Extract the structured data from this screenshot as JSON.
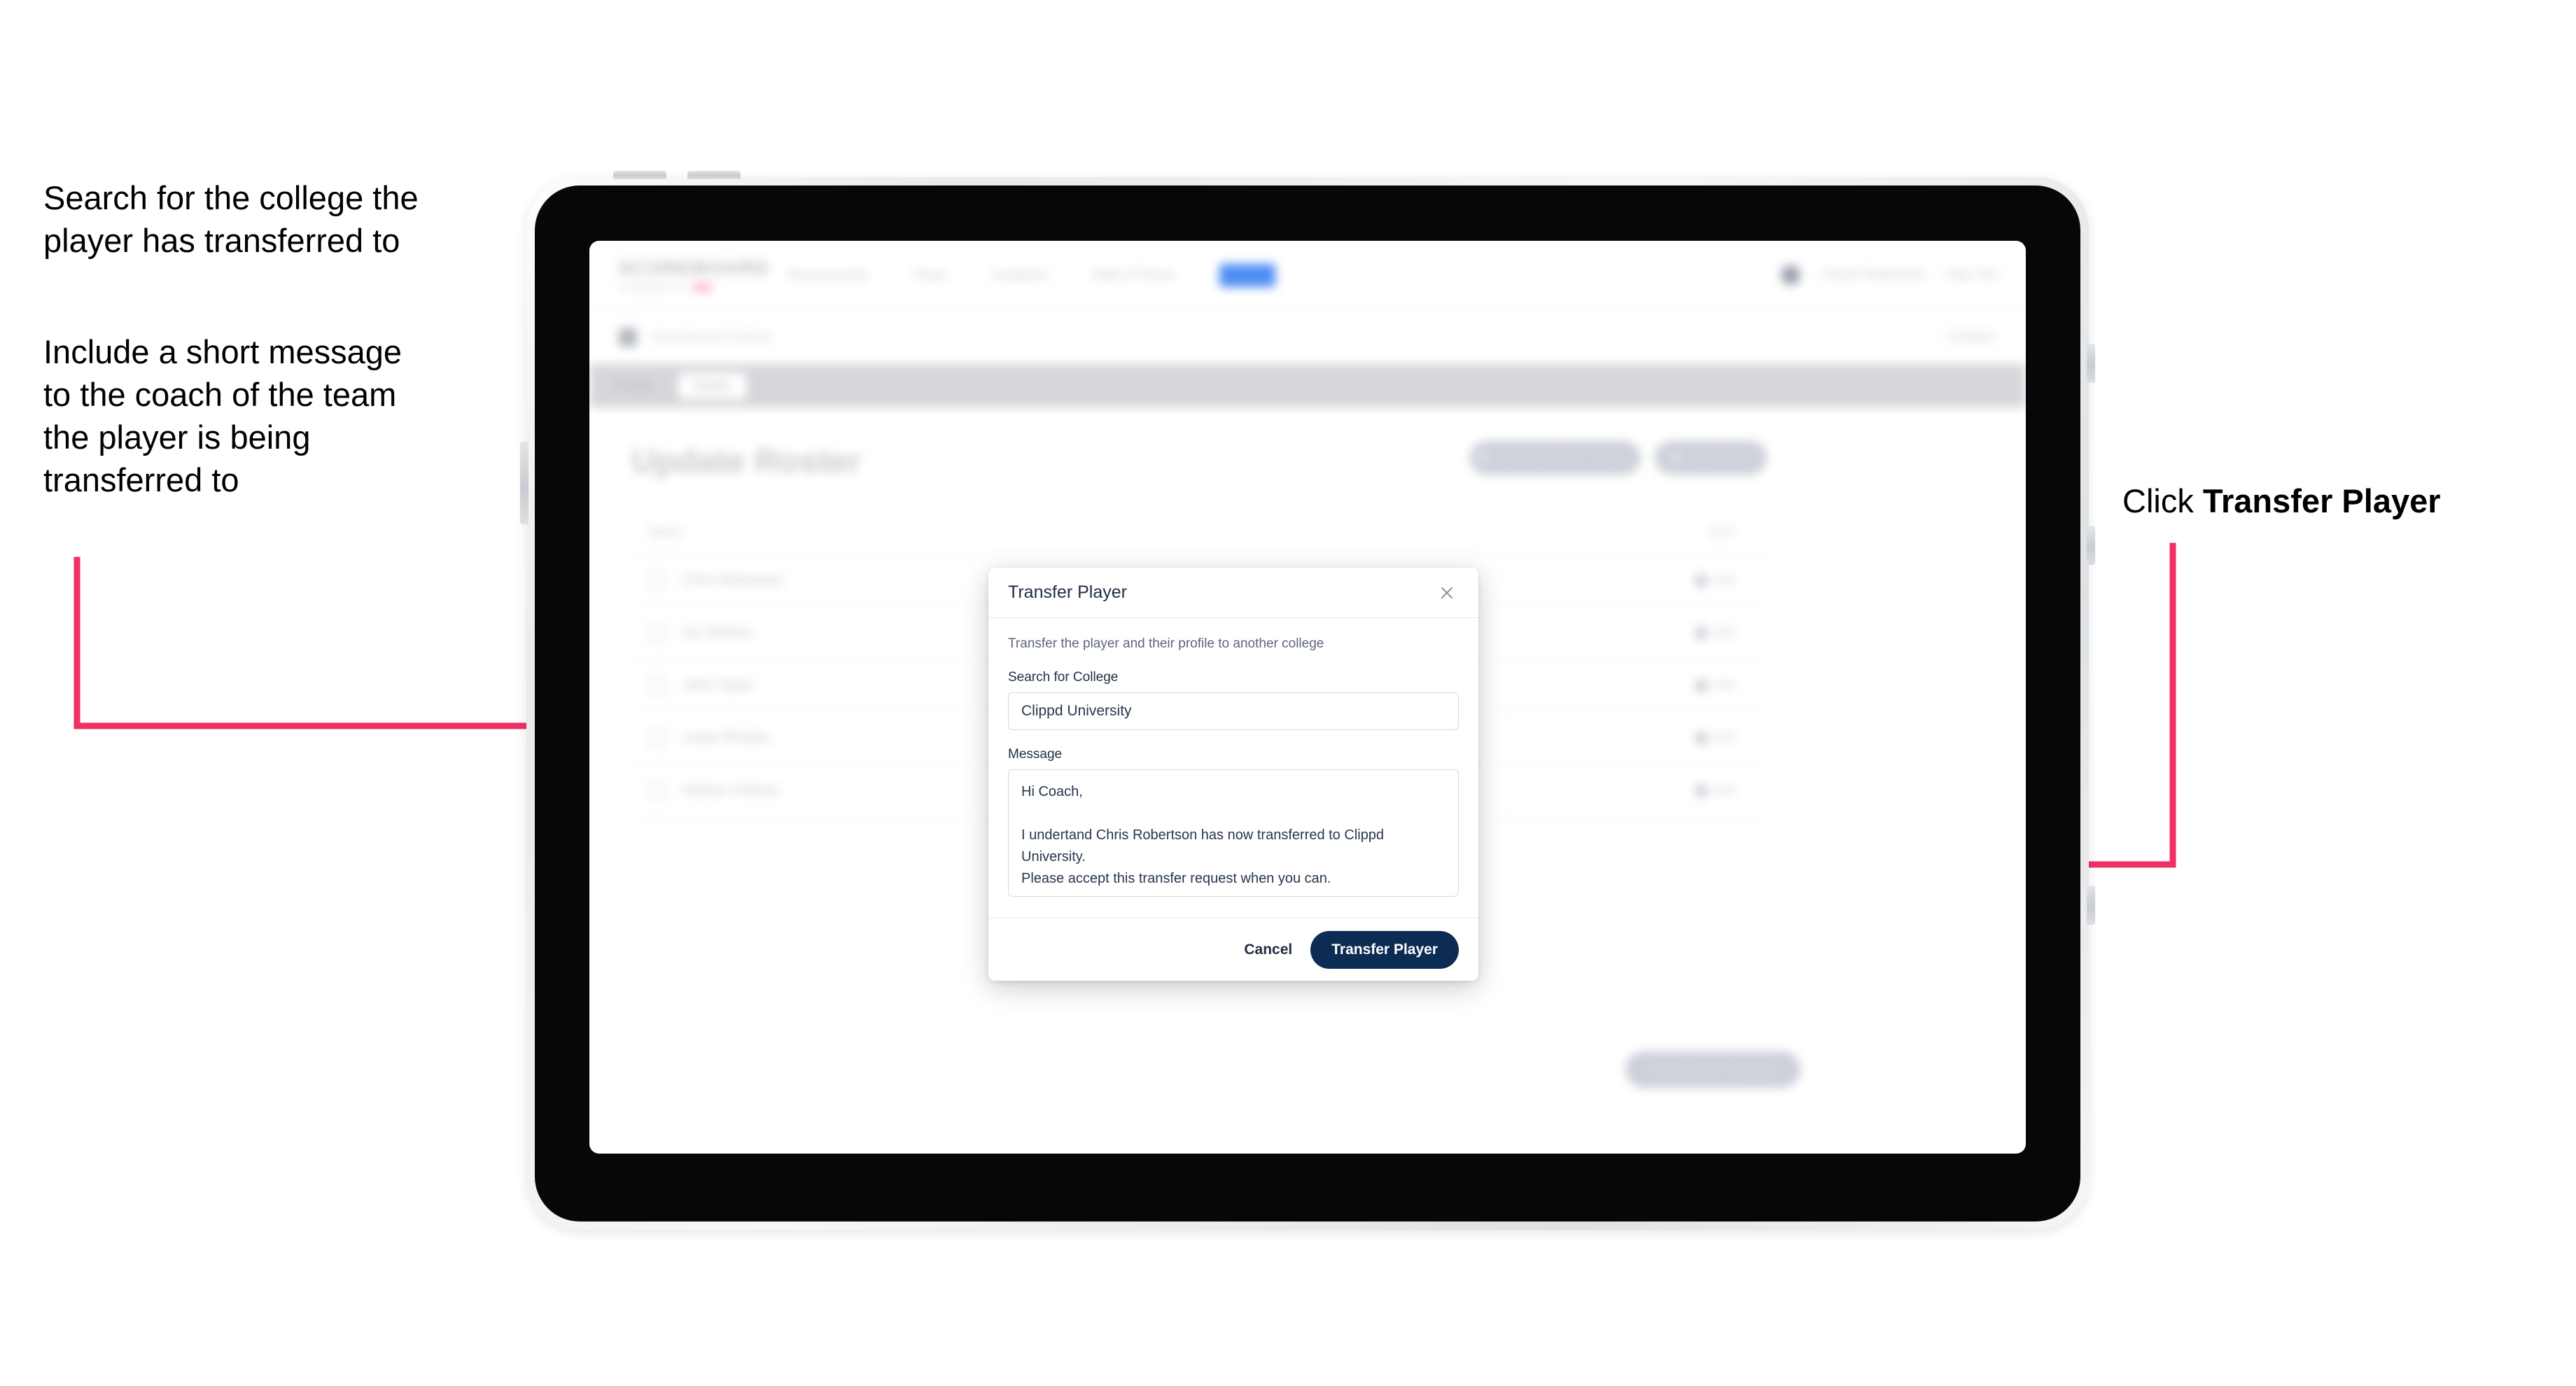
{
  "annotations": {
    "left_1": "Search for the college the\nplayer has transferred to",
    "left_2": "Include a short message\nto the coach of the team\nthe player is being\ntransferred to",
    "right_prefix": "Click ",
    "right_bold": "Transfer Player",
    "arrow_color": "#f02f65"
  },
  "app": {
    "brand": {
      "name": "SCOREBOARD",
      "tagline": "POWERED BY",
      "chip": "clippd"
    },
    "nav": [
      {
        "label": "Tournaments",
        "active": false
      },
      {
        "label": "Team",
        "active": false
      },
      {
        "label": "Analytics",
        "active": false
      },
      {
        "label": "Wall of Fame",
        "active": false
      },
      {
        "label": "Admin",
        "active": true
      }
    ],
    "nav_right": {
      "avatar": "avatar-icon",
      "user": "Coach Robertson",
      "signout": "Sign Out"
    },
    "subbar": {
      "icon": "scoreboard-icon",
      "title": "Scoreboard",
      "title_suffix": " Admin",
      "right": "Contact"
    },
    "tabs": [
      {
        "label": "Events",
        "active": false
      },
      {
        "label": "Roster",
        "active": true
      }
    ],
    "page_title": "Update Roster",
    "header_buttons": [
      {
        "label": "Request Player Transfer",
        "icon": "transfer-icon"
      },
      {
        "label": "Add Player",
        "icon": "plus-icon"
      }
    ],
    "table": {
      "columns": [
        "Name",
        "EDIT"
      ],
      "rows": [
        {
          "name": "Chris Robertson",
          "action": "Edit"
        },
        {
          "name": "Ian Winters",
          "action": "Edit"
        },
        {
          "name": "John Taylor",
          "action": "Edit"
        },
        {
          "name": "Lewis Rhodes",
          "action": "Edit"
        },
        {
          "name": "Nathan Holmes",
          "action": "Edit"
        }
      ]
    },
    "submit_button": "Save Roster Changes"
  },
  "modal": {
    "title": "Transfer Player",
    "close_icon": "close-icon",
    "description": "Transfer the player and their profile to another college",
    "college_label": "Search for College",
    "college_value": "Clippd University",
    "college_placeholder": "Search for College",
    "message_label": "Message",
    "message_value": "Hi Coach,\n\nI undertand Chris Robertson has now transferred to Clippd University.\nPlease accept this transfer request when you can.",
    "message_placeholder": "Message",
    "cancel_label": "Cancel",
    "transfer_label": "Transfer Player",
    "transfer_button_color": "#0d2c54"
  }
}
